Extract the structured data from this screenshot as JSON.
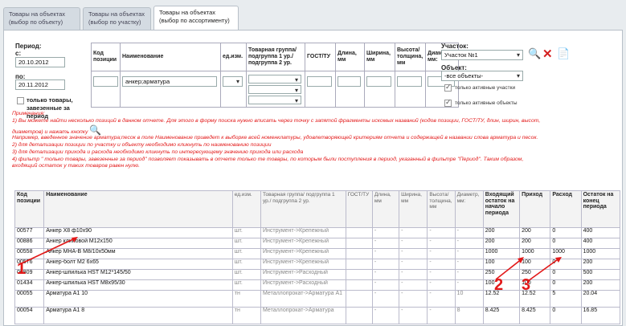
{
  "tabs": [
    {
      "line1": "Товары на объектах",
      "line2": "(выбор по объекту)"
    },
    {
      "line1": "Товары на объектах",
      "line2": "(выбор по участку)"
    },
    {
      "line1": "Товары на объектах",
      "line2": "(выбор по ассортименту)"
    }
  ],
  "period": {
    "label": "Период:",
    "from_label": "с:",
    "from_value": "20.10.2012",
    "to_label": "по:",
    "to_value": "20.11.2012",
    "only_delivered_label": "только товары, завезенные за период"
  },
  "filter_headers": [
    "Код позиции",
    "Наименование",
    "ед.изм.",
    "Товарная группа/ подгруппа 1 ур./ подгруппа 2 ур.",
    "ГОСТ/ТУ",
    "Длина, мм",
    "Ширина, мм",
    "Высота/ толщина, мм",
    "Диаметр, мм:"
  ],
  "filter": {
    "name_value": "анкер;арматура"
  },
  "site": {
    "label": "Участок:",
    "value": "Участок №1",
    "object_label": "Объект:",
    "object_value": "-все объекты-",
    "only_active_sites": "только активные участки",
    "only_active_objects": "только активные объекты"
  },
  "notes": {
    "title": "Примечания:",
    "line1": "1) Вы можете найти несколько позиций в данном отчете. Для этого в форму поиска нужно вписать через точку с запятой фрагменты искомых названий (кодов позиции, ГОСТ/ТУ, длин, ширин, высот,",
    "line2": "диаметров) и нажать кнопку",
    "line3": "Например, введенное значение арматура;песок в поле Наименование приведет к выборке всей номенклатуры, удовлетворяющей критериям отчета и содержащей в названии слова арматура и песок.",
    "line4": "2) для детализации позиции по участку и объекту необходимо кликнуть по наименованию позиции",
    "line5": "3) для детализации прихода и расхода необходимо кликнуть по интересующему значению прихода или расхода",
    "line6": "4) фильтр \" только товары, завезенные за период\" позволяет показывать в отчете только те товары, по которым были поступления в период, указанный в фильтре \"Период\". Таким образом,",
    "line7": "входящий остаток у таких товаров равен нулю."
  },
  "table": {
    "headers": [
      "Код позиции",
      "Наименование",
      "ед.изм.",
      "Товарная группа/ подгруппа 1 ур./ подгруппа 2 ур.",
      "ГОСТ/ТУ",
      "Длина, мм",
      "Ширина, мм",
      "Высота/ толщина, мм",
      "Диаметр, мм:",
      "Входящий остаток на начало периода",
      "Приход",
      "Расход",
      "Остаток на конец периода"
    ],
    "rows": [
      [
        "00577",
        "Анкер Х8 ф10х90",
        "шт.",
        "Инструмент->Крепежный",
        "",
        "-",
        "-",
        "-",
        "-",
        "200",
        "200",
        "0",
        "400"
      ],
      [
        "00886",
        "Анкер клиновой М12х150",
        "шт.",
        "Инструмент->Крепежный",
        "",
        "-",
        "-",
        "-",
        "-",
        "200",
        "200",
        "0",
        "400"
      ],
      [
        "00558",
        "Анкер МНА-В М8/10х50мм",
        "шт.",
        "Инструмент->Крепежный",
        "",
        "-",
        "-",
        "-",
        "-",
        "1000",
        "1000",
        "1000",
        "1000"
      ],
      [
        "00576",
        "Анкер-болт М2 6х65",
        "шт.",
        "Инструмент->Крепежный",
        "",
        "-",
        "-",
        "-",
        "-",
        "100",
        "100",
        "0",
        "200"
      ],
      [
        "00809",
        "Анкер-шпилька HST M12*145/50",
        "шт.",
        "Инструмент->Расходный",
        "",
        "-",
        "-",
        "-",
        "-",
        "250",
        "250",
        "0",
        "500"
      ],
      [
        "01434",
        "Анкер-шпилька HST M8х95/30",
        "шт.",
        "Инструмент->Расходный",
        "",
        "-",
        "-",
        "-",
        "-",
        "100",
        "100",
        "0",
        "200"
      ],
      [
        "00055",
        "Арматура А1 10",
        "тн",
        "Металлопрокат->Арматура А1",
        "",
        "-",
        "-",
        "-",
        "10",
        "12.52",
        "12.52",
        "5",
        "20.04"
      ],
      [
        "00054",
        "Арматура А1 8",
        "тн",
        "Металлопрокат->Арматура",
        "",
        "-",
        "-",
        "-",
        "8",
        "8.425",
        "8.425",
        "0",
        "16.85"
      ]
    ]
  },
  "annotations": [
    "1",
    "2",
    "3"
  ],
  "colors": {
    "accent_red": "#e21818",
    "tab_bg": "#d4dbe2"
  }
}
